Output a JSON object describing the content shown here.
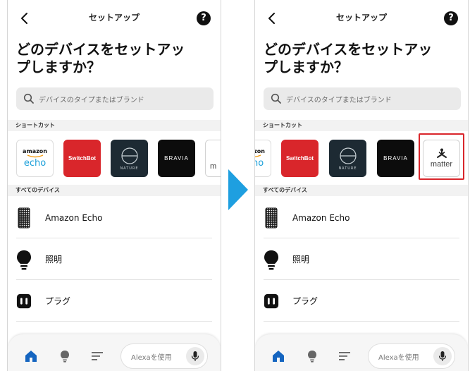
{
  "header": {
    "title": "セットアップ",
    "help_label": "?"
  },
  "heading": {
    "line1": "どのデバイスをセットアッ",
    "line2": "プしますか？"
  },
  "search": {
    "placeholder": "デバイスのタイプまたはブランド"
  },
  "sections": {
    "shortcuts": "ショートカット",
    "all_devices": "すべてのデバイス"
  },
  "shortcuts": {
    "amazon_top": "amazon",
    "amazon_bottom": "echo",
    "switchbot": "SwitchBot",
    "nature": "NATURE",
    "bravia": "BRAVIA",
    "matter": "matter",
    "matter_partial": "m"
  },
  "devices": [
    {
      "label": "Amazon Echo",
      "icon": "echo-speaker-icon"
    },
    {
      "label": "照明",
      "icon": "light-bulb-icon"
    },
    {
      "label": "プラグ",
      "icon": "smart-plug-icon"
    }
  ],
  "bottom_nav": {
    "items": [
      "home-icon",
      "devices-bulb-icon",
      "menu-icon"
    ],
    "alexa_label": "Alexaを使用"
  },
  "colors": {
    "accent_blue": "#1565c0",
    "arrow_blue": "#1e9fe0",
    "highlight_red": "#d9262b",
    "switchbot_red": "#d9262b",
    "nature_bg": "#1d2a33"
  }
}
